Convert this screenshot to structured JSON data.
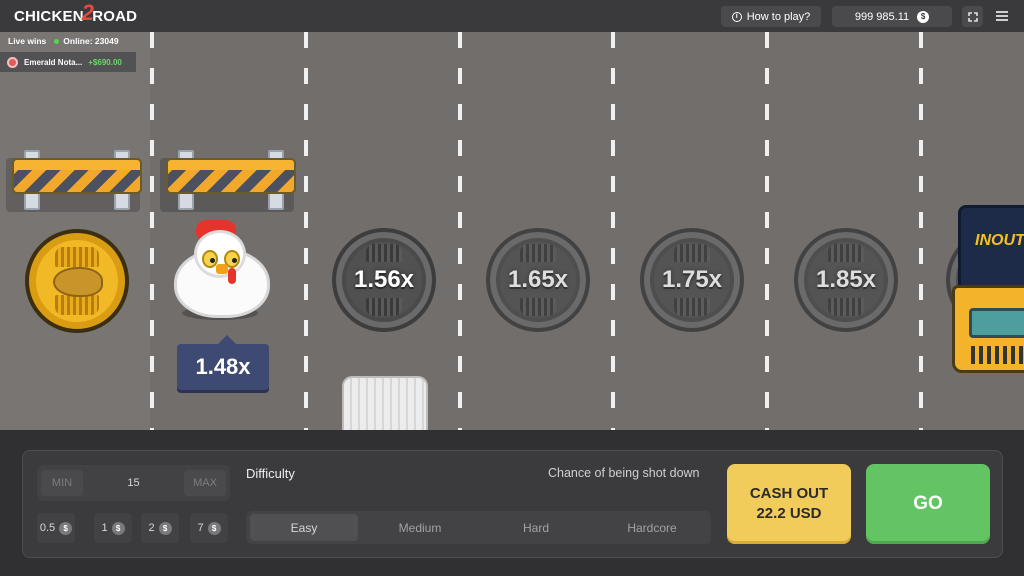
{
  "header": {
    "logo_left": "CHICKEN",
    "logo_mid": "2",
    "logo_right": "ROAD",
    "how_to_play": "How to play?",
    "balance": "999 985.11",
    "currency_symbol": "$",
    "menu_icon": "menu-icon",
    "fullscreen_icon": "fullscreen-icon"
  },
  "live": {
    "label": "Live wins",
    "online": "Online: 23049",
    "winner_name": "Emerald Nota...",
    "winner_amount": "+$690.00"
  },
  "road": {
    "current_multiplier": "1.48x",
    "upcoming_multipliers": [
      "1.56x",
      "1.65x",
      "1.75x",
      "1.85x"
    ],
    "truck_brand": "INOUT"
  },
  "controls": {
    "min_label": "MIN",
    "max_label": "MAX",
    "bet_value": "15",
    "quick_bets": [
      "0.5",
      "1",
      "2",
      "7"
    ],
    "difficulty_label": "Difficulty",
    "chance_label": "Chance of being shot down",
    "difficulties": [
      "Easy",
      "Medium",
      "Hard",
      "Hardcore"
    ],
    "selected_difficulty": "Easy",
    "cashout_line1": "CASH OUT",
    "cashout_line2": "22.2 USD",
    "go_label": "GO"
  },
  "colors": {
    "cashout": "#f2cc5a",
    "go": "#62c462",
    "road": "#716e6c",
    "badge": "#3f4a72"
  }
}
